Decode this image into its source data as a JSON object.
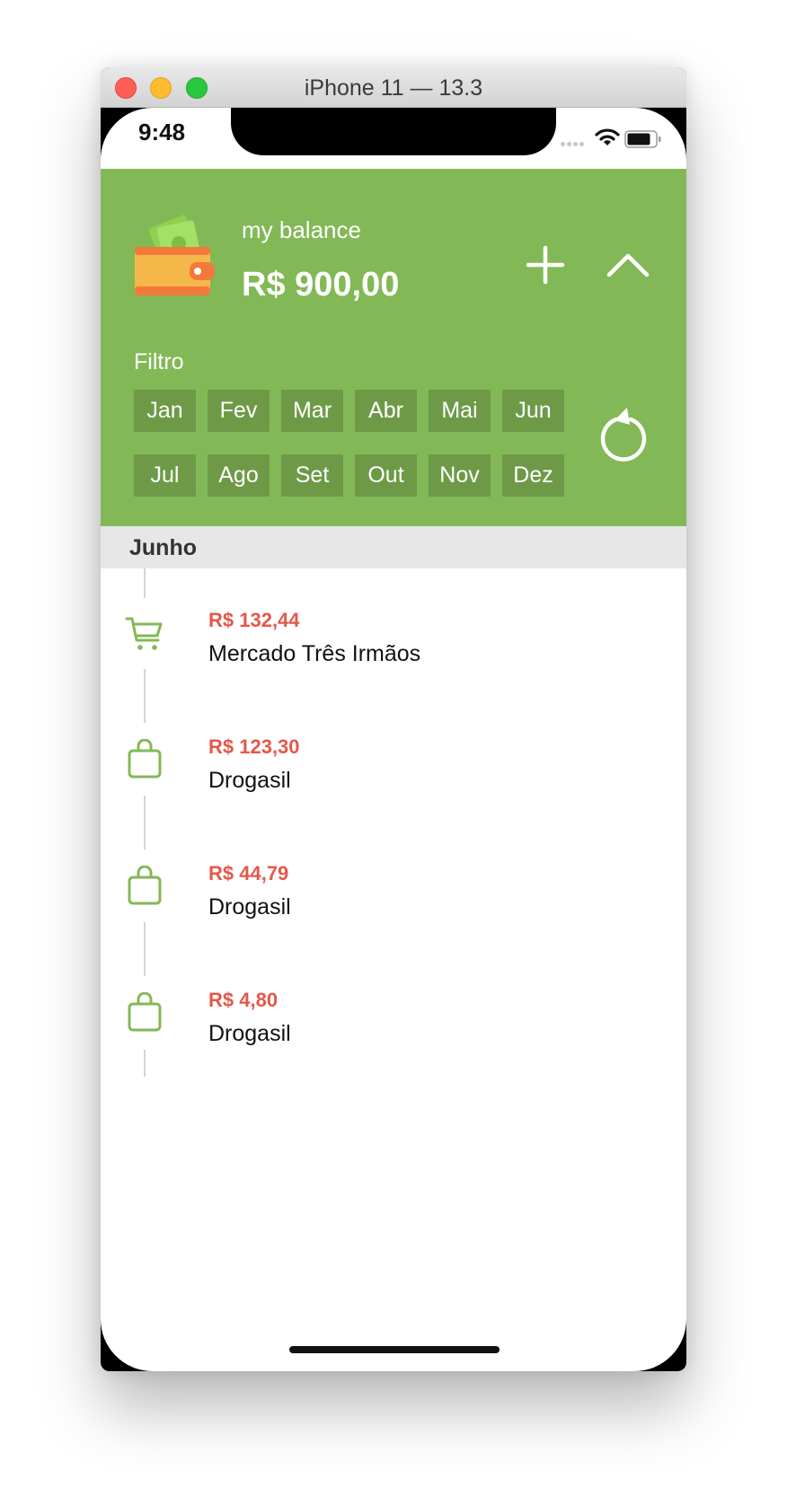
{
  "window": {
    "title": "iPhone 11 — 13.3"
  },
  "status_bar": {
    "time": "9:48"
  },
  "header": {
    "balance_label": "my balance",
    "balance_value": "R$ 900,00",
    "filter_label": "Filtro",
    "months": [
      "Jan",
      "Fev",
      "Mar",
      "Abr",
      "Mai",
      "Jun",
      "Jul",
      "Ago",
      "Set",
      "Out",
      "Nov",
      "Dez"
    ]
  },
  "section": {
    "title": "Junho"
  },
  "transactions": [
    {
      "amount": "R$ 132,44",
      "name": "Mercado Três Irmãos",
      "icon": "cart-icon"
    },
    {
      "amount": "R$ 123,30",
      "name": "Drogasil",
      "icon": "bag-icon"
    },
    {
      "amount": "R$ 44,79",
      "name": "Drogasil",
      "icon": "bag-icon"
    },
    {
      "amount": "R$ 4,80",
      "name": "Drogasil",
      "icon": "bag-icon"
    }
  ],
  "colors": {
    "header_green": "#83b857",
    "month_button": "#6e9a48",
    "amount_red": "#e5574b",
    "icon_green": "#83b857",
    "section_bg": "#e7e7e7"
  }
}
